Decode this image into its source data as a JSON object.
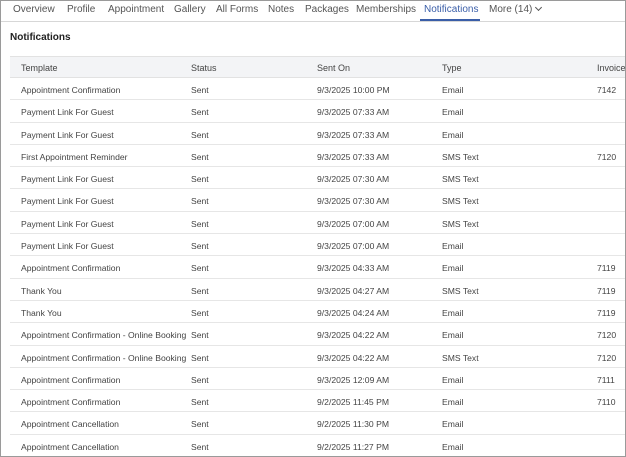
{
  "tabs": [
    {
      "label": "Overview"
    },
    {
      "label": "Profile"
    },
    {
      "label": "Appointment"
    },
    {
      "label": "Gallery"
    },
    {
      "label": "All Forms"
    },
    {
      "label": "Notes"
    },
    {
      "label": "Packages"
    },
    {
      "label": "Memberships"
    },
    {
      "label": "Notifications",
      "active": true
    },
    {
      "label": "More (14)"
    }
  ],
  "section_title": "Notifications",
  "columns": [
    "Template",
    "Status",
    "Sent On",
    "Type",
    "Invoice N"
  ],
  "rows": [
    {
      "template": "Appointment Confirmation",
      "status": "Sent",
      "sent_on": "9/3/2025 10:00 PM",
      "type": "Email",
      "invoice": "7142"
    },
    {
      "template": "Payment Link For Guest",
      "status": "Sent",
      "sent_on": "9/3/2025 07:33 AM",
      "type": "Email",
      "invoice": ""
    },
    {
      "template": "Payment Link For Guest",
      "status": "Sent",
      "sent_on": "9/3/2025 07:33 AM",
      "type": "Email",
      "invoice": ""
    },
    {
      "template": "First Appointment Reminder",
      "status": "Sent",
      "sent_on": "9/3/2025 07:33 AM",
      "type": "SMS Text",
      "invoice": "7120"
    },
    {
      "template": "Payment Link For Guest",
      "status": "Sent",
      "sent_on": "9/3/2025 07:30 AM",
      "type": "SMS Text",
      "invoice": ""
    },
    {
      "template": "Payment Link For Guest",
      "status": "Sent",
      "sent_on": "9/3/2025 07:30 AM",
      "type": "SMS Text",
      "invoice": ""
    },
    {
      "template": "Payment Link For Guest",
      "status": "Sent",
      "sent_on": "9/3/2025 07:00 AM",
      "type": "SMS Text",
      "invoice": ""
    },
    {
      "template": "Payment Link For Guest",
      "status": "Sent",
      "sent_on": "9/3/2025 07:00 AM",
      "type": "Email",
      "invoice": ""
    },
    {
      "template": "Appointment Confirmation",
      "status": "Sent",
      "sent_on": "9/3/2025 04:33 AM",
      "type": "Email",
      "invoice": "7119"
    },
    {
      "template": "Thank You",
      "status": "Sent",
      "sent_on": "9/3/2025 04:27 AM",
      "type": "SMS Text",
      "invoice": "7119"
    },
    {
      "template": "Thank You",
      "status": "Sent",
      "sent_on": "9/3/2025 04:24 AM",
      "type": "Email",
      "invoice": "7119"
    },
    {
      "template": "Appointment Confirmation - Online Booking",
      "status": "Sent",
      "sent_on": "9/3/2025 04:22 AM",
      "type": "Email",
      "invoice": "7120"
    },
    {
      "template": "Appointment Confirmation - Online Booking",
      "status": "Sent",
      "sent_on": "9/3/2025 04:22 AM",
      "type": "SMS Text",
      "invoice": "7120"
    },
    {
      "template": "Appointment Confirmation",
      "status": "Sent",
      "sent_on": "9/3/2025 12:09 AM",
      "type": "Email",
      "invoice": "7111"
    },
    {
      "template": "Appointment Confirmation",
      "status": "Sent",
      "sent_on": "9/2/2025 11:45 PM",
      "type": "Email",
      "invoice": "7110"
    },
    {
      "template": "Appointment Cancellation",
      "status": "Sent",
      "sent_on": "9/2/2025 11:30 PM",
      "type": "Email",
      "invoice": ""
    },
    {
      "template": "Appointment Cancellation",
      "status": "Sent",
      "sent_on": "9/2/2025 11:27 PM",
      "type": "Email",
      "invoice": ""
    }
  ],
  "colors": {
    "accent": "#3a5ea8",
    "header_bg": "#f3f4f6"
  },
  "icons": {
    "more_dropdown": "chevron-down-icon"
  }
}
